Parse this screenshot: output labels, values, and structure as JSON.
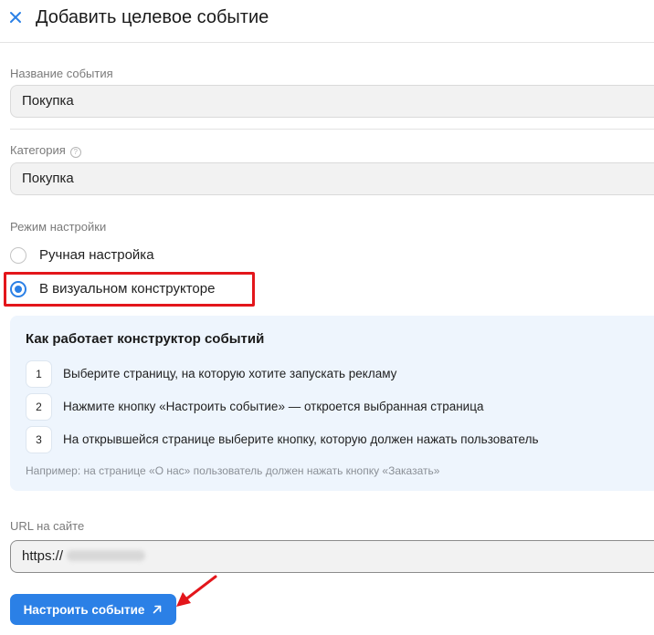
{
  "header": {
    "title": "Добавить целевое событие",
    "close_icon": "close-icon"
  },
  "event_name": {
    "label": "Название события",
    "value": "Покупка"
  },
  "category": {
    "label": "Категория",
    "help_icon": "?",
    "value": "Покупка"
  },
  "setup_mode": {
    "label": "Режим настройки",
    "options": [
      {
        "label": "Ручная настройка",
        "checked": false
      },
      {
        "label": "В визуальном конструкторе",
        "checked": true
      }
    ]
  },
  "info_panel": {
    "title": "Как работает конструктор событий",
    "steps": [
      {
        "num": "1",
        "text": "Выберите страницу, на которую хотите запускать рекламу"
      },
      {
        "num": "2",
        "text": "Нажмите кнопку «Настроить событие» — откроется выбранная страница"
      },
      {
        "num": "3",
        "text": "На открывшейся странице выберите кнопку, которую должен нажать пользователь"
      }
    ],
    "note": "Например: на странице «О нас» пользователь должен нажать кнопку «Заказать»"
  },
  "url": {
    "label": "URL на сайте",
    "value": "https://"
  },
  "actions": {
    "configure_label": "Настроить событие"
  },
  "colors": {
    "accent": "#2b80e6",
    "highlight": "#e3161b",
    "panel_bg": "#eef5fd"
  }
}
